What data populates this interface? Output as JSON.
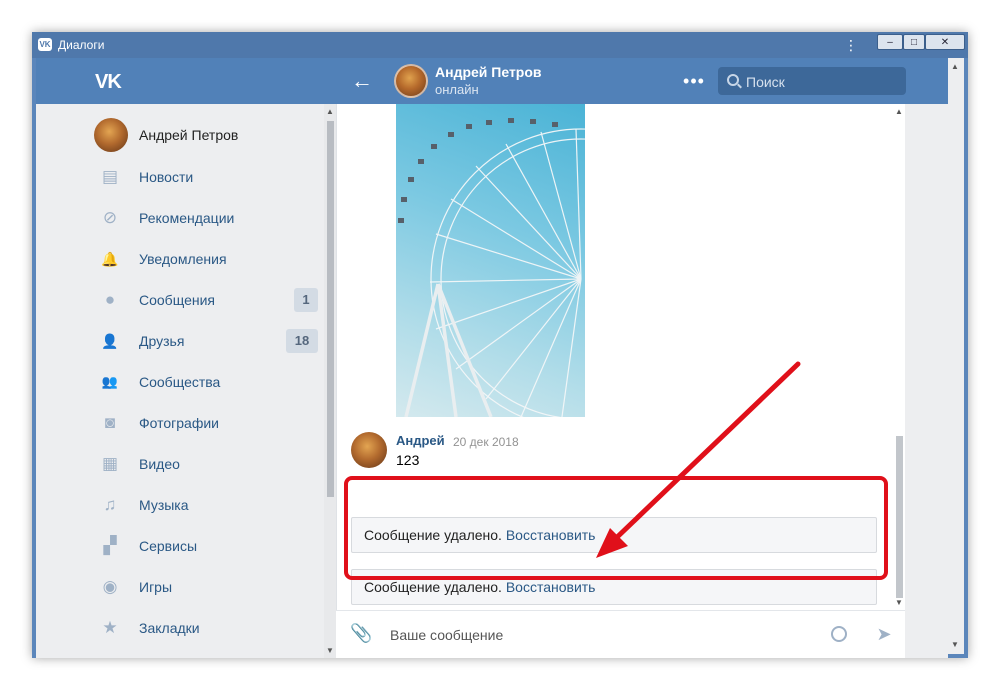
{
  "window": {
    "title": "Диалоги",
    "logo_text": "VK",
    "menu_glyph": "⋮",
    "min_glyph": "–",
    "max_glyph": "□",
    "close_glyph": "✕"
  },
  "header": {
    "logo_text": "VK",
    "back_glyph": "←",
    "contact_name": "Андрей Петров",
    "contact_status": "онлайн",
    "more_glyph": "•••",
    "search_placeholder": "Поиск"
  },
  "sidebar": {
    "profile_name": "Андрей Петров",
    "items": [
      {
        "label": "Новости",
        "icon": "news-icon",
        "glyph": "▤"
      },
      {
        "label": "Рекомендации",
        "icon": "compass-icon",
        "glyph": "⊘"
      },
      {
        "label": "Уведомления",
        "icon": "bell-icon",
        "glyph": "🔔"
      },
      {
        "label": "Сообщения",
        "icon": "message-icon",
        "glyph": "●",
        "badge": "1"
      },
      {
        "label": "Друзья",
        "icon": "friends-icon",
        "glyph": "👤",
        "badge": "18"
      },
      {
        "label": "Сообщества",
        "icon": "communities-icon",
        "glyph": "👥"
      },
      {
        "label": "Фотографии",
        "icon": "camera-icon",
        "glyph": "◙"
      },
      {
        "label": "Видео",
        "icon": "video-icon",
        "glyph": "▦"
      },
      {
        "label": "Музыка",
        "icon": "music-icon",
        "glyph": "♫"
      },
      {
        "label": "Сервисы",
        "icon": "services-icon",
        "glyph": "▞"
      },
      {
        "label": "Игры",
        "icon": "gamepad-icon",
        "glyph": "◉"
      },
      {
        "label": "Закладки",
        "icon": "star-icon",
        "glyph": "★"
      }
    ]
  },
  "chat": {
    "message": {
      "author": "Андрей",
      "date": "20 дек 2018",
      "text": "123"
    },
    "deleted_messages": [
      {
        "text": "Сообщение удалено.",
        "restore": "Восстановить"
      },
      {
        "text": "Сообщение удалено.",
        "restore": "Восстановить"
      }
    ],
    "composer_placeholder": "Ваше сообщение",
    "clip_glyph": "📎",
    "send_glyph": "➤"
  },
  "colors": {
    "header_blue": "#5181b8",
    "link_blue": "#2a5885",
    "highlight_red": "#e0101a"
  }
}
